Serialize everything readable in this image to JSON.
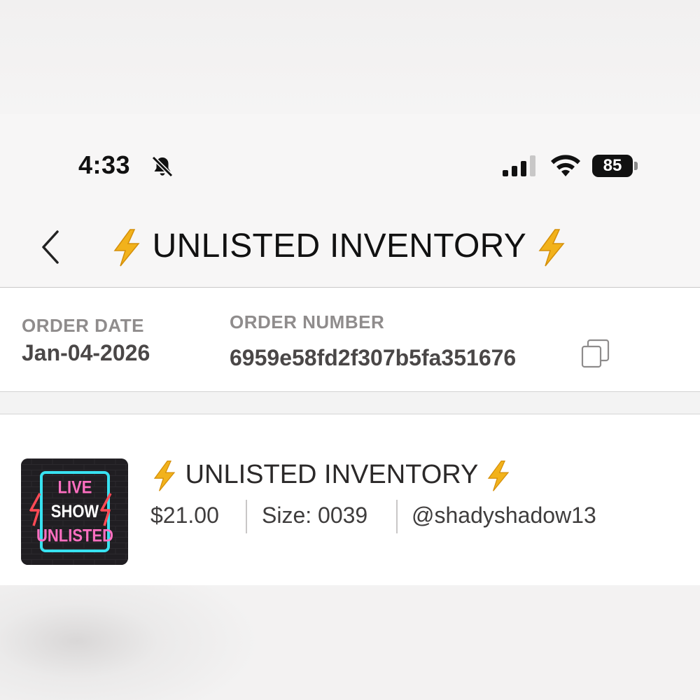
{
  "status_bar": {
    "time": "4:33",
    "silent_icon": "bell-slash-icon",
    "signal_icon": "cellular-signal-icon",
    "wifi_icon": "wifi-icon",
    "battery_percent": "85"
  },
  "header": {
    "back_icon": "chevron-left-icon",
    "title": "UNLISTED INVENTORY",
    "title_emoji": "lightning-bolt-icon"
  },
  "order": {
    "date_label": "ORDER DATE",
    "date_value": "Jan-04-2026",
    "number_label": "ORDER NUMBER",
    "number_value": "6959e58fd2f307b5fa351676",
    "copy_icon": "copy-icon"
  },
  "item": {
    "thumbnail_text": [
      "LIVE",
      "SHOW",
      "UNLISTED"
    ],
    "title": "UNLISTED INVENTORY",
    "price": "$21.00",
    "size": "Size: 0039",
    "seller": "@shadyshadow13"
  },
  "colors": {
    "bolt": "#f2b21b",
    "neon_pink": "#ff5fb8",
    "neon_cyan": "#38e1f0",
    "neon_red": "#ff4a55"
  }
}
